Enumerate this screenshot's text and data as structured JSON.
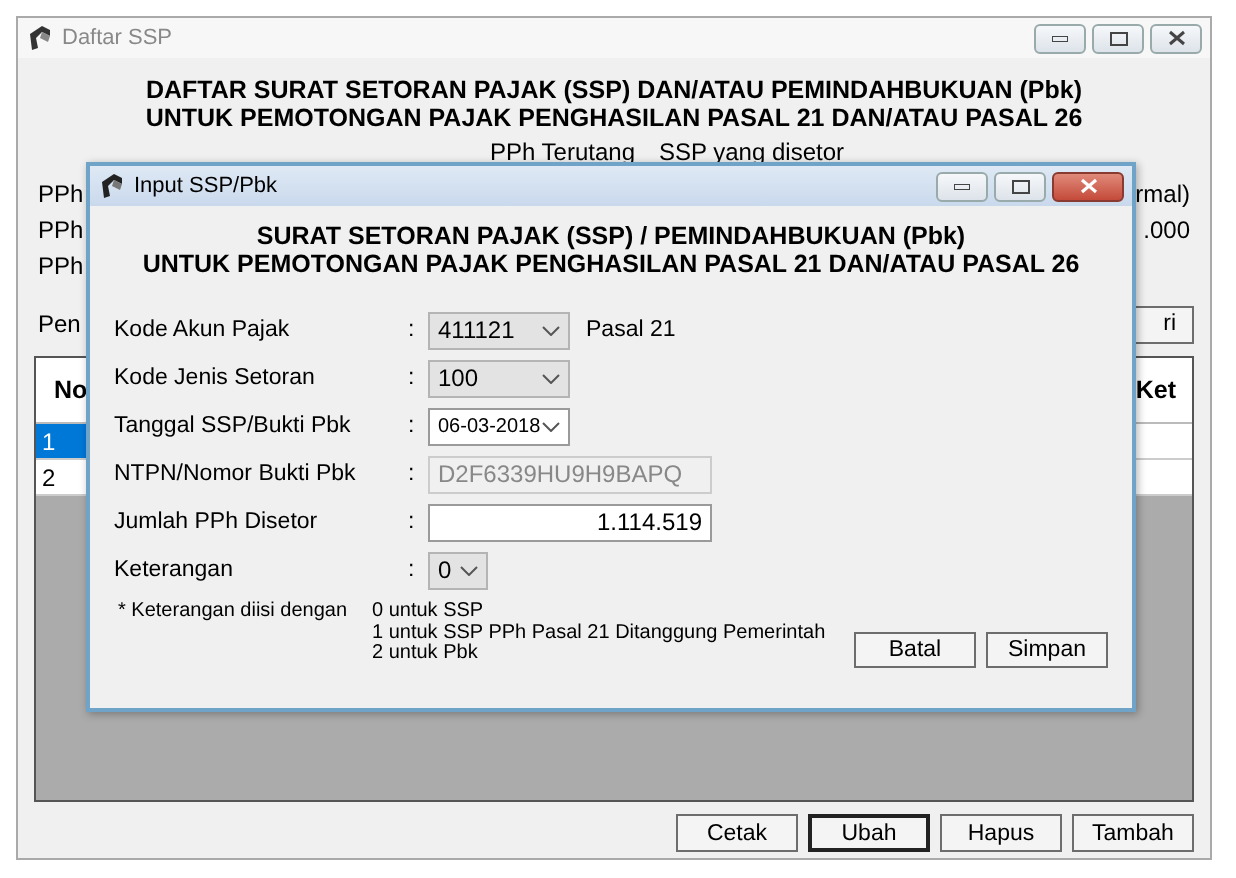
{
  "window": {
    "title": "Daftar SSP",
    "heading": [
      "DAFTAR SURAT SETORAN PAJAK (SSP) DAN/ATAU PEMINDAHBUKUAN (Pbk)",
      "UNTUK PEMOTONGAN PAJAK PENGHASILAN PASAL 21 DAN/ATAU PASAL 26"
    ],
    "column_headings": [
      "PPh Terutang",
      "SSP yang disetor"
    ],
    "summary_rows": [
      {
        "label": "PPh",
        "value": "rmal)"
      },
      {
        "label": "PPh",
        "value": ".000"
      },
      {
        "label": "PPh"
      }
    ],
    "search": {
      "label": "Pen",
      "button": "ri"
    },
    "table": {
      "columns": [
        "No",
        "Ket"
      ],
      "rows": [
        {
          "cells": [
            "1"
          ],
          "selected": true
        },
        {
          "cells": [
            "2"
          ],
          "selected": false
        }
      ]
    },
    "buttons": [
      {
        "label": "Cetak",
        "default": false
      },
      {
        "label": "Ubah",
        "default": true
      },
      {
        "label": "Hapus",
        "default": false
      },
      {
        "label": "Tambah",
        "default": false
      }
    ]
  },
  "dialog": {
    "title": "Input SSP/Pbk",
    "heading": [
      "SURAT SETORAN PAJAK (SSP) / PEMINDAHBUKUAN (Pbk)",
      "UNTUK PEMOTONGAN PAJAK PENGHASILAN PASAL 21 DAN/ATAU PASAL 26"
    ],
    "fields": [
      {
        "kind": "select",
        "label": "Kode Akun Pajak",
        "separator": ":",
        "value": "411121",
        "note": "Pasal 21"
      },
      {
        "kind": "select",
        "label": "Kode Jenis Setoran",
        "separator": ":",
        "value": "100"
      },
      {
        "kind": "date",
        "label": "Tanggal SSP/Bukti Pbk",
        "separator": ":",
        "value": "06-03-2018"
      },
      {
        "kind": "text",
        "label": "NTPN/Nomor Bukti Pbk",
        "separator": ":",
        "value": "D2F6339HU9H9BAPQ",
        "disabled": true
      },
      {
        "kind": "number",
        "label": "Jumlah PPh Disetor",
        "separator": ":",
        "value": "1.114.519",
        "disabled": false
      },
      {
        "kind": "small-select",
        "label": "Keterangan",
        "separator": ":",
        "value": "0"
      }
    ],
    "note": {
      "label": "* Keterangan diisi dengan",
      "lines": [
        "0 untuk SSP",
        "1 untuk SSP PPh Pasal 21 Ditanggung Pemerintah",
        "2 untuk Pbk"
      ]
    },
    "buttons": [
      "Batal",
      "Simpan"
    ]
  }
}
